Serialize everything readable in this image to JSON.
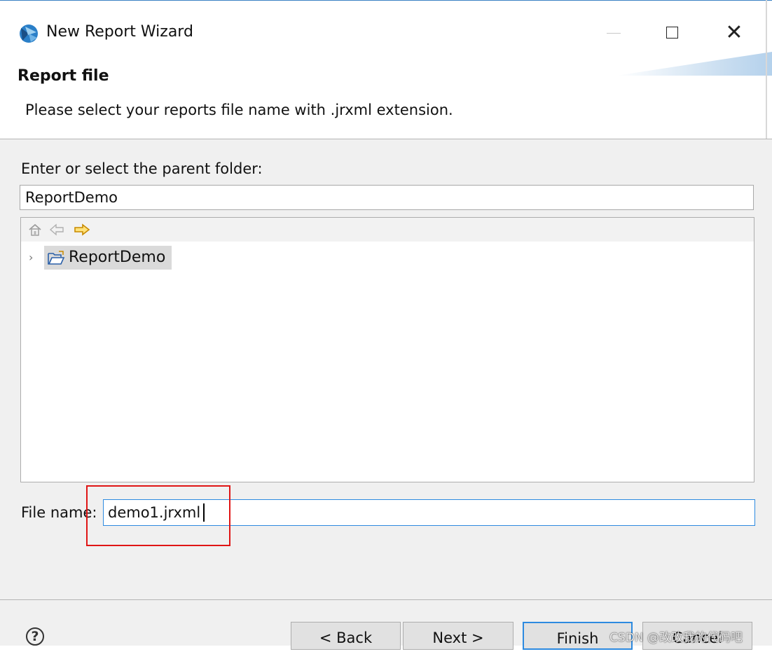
{
  "window": {
    "title": "New Report Wizard",
    "close_glyph": "✕"
  },
  "header": {
    "title": "Report file",
    "description": "Please select your reports file name with .jrxml extension."
  },
  "folder": {
    "label": "Enter or select the parent folder:",
    "value": "ReportDemo"
  },
  "tree": {
    "toolbar_icons": [
      "home-icon",
      "back-arrow-icon",
      "forward-arrow-icon"
    ],
    "items": [
      {
        "label": "ReportDemo",
        "icon": "open-folder-icon",
        "expanded": false,
        "selected": true
      }
    ],
    "chevron": "›"
  },
  "file": {
    "label": "File name:",
    "value": "demo1.jrxml"
  },
  "buttons": {
    "help": "?",
    "back": "< Back",
    "next": "Next >",
    "finish": "Finish",
    "cancel": "Cancel"
  },
  "colors": {
    "focus_border": "#2d8ae0",
    "highlight_annotation": "#e01515",
    "dialog_background": "#f0f0f0"
  },
  "watermark": "CSDN @改改我的代码吧"
}
